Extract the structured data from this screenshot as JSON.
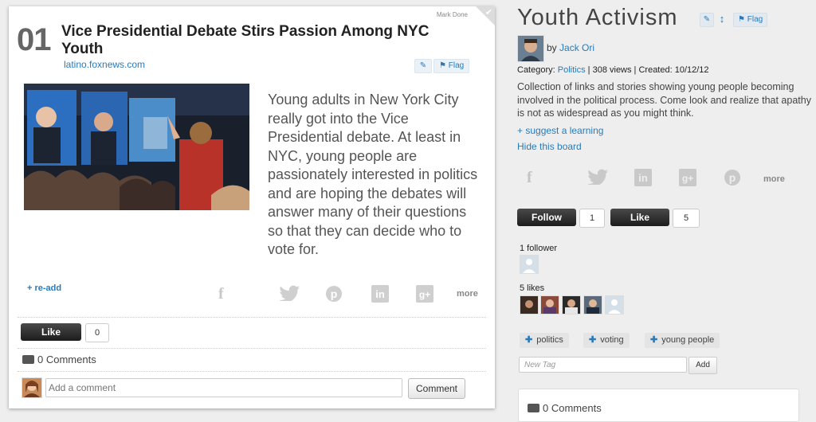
{
  "card": {
    "mark_done": "Mark Done",
    "number": "01",
    "title": "Vice Presidential Debate Stirs Passion Among NYC Youth",
    "source": "latino.foxnews.com",
    "flag_label": "Flag",
    "description": "Young adults in New York City really got into the Vice Presidential debate. At least in NYC, young people are passionately interested in politics and are hoping the debates will answer many of their questions so that they can decide who to vote for.",
    "readd_label": "+ re-add",
    "share_more": "more",
    "like_label": "Like",
    "like_count": "0",
    "comments_label": "0 Comments",
    "comment_placeholder": "Add a comment",
    "comment_button": "Comment"
  },
  "board": {
    "title": "Youth Activism",
    "flag_label": "Flag",
    "by_prefix": "by",
    "author": "Jack Ori",
    "category_prefix": "Category:",
    "category": "Politics",
    "stats": "| 308 views | Created: 10/12/12",
    "description": "Collection of links and stories showing young people becoming involved in the political process. Come look and realize that apathy is not as widespread as you might think.",
    "suggest_label": "+ suggest a learning",
    "hide_label": "Hide this board",
    "share_more": "more",
    "follow_label": "Follow",
    "follow_count": "1",
    "like_label": "Like",
    "like_count": "5",
    "followers_label": "1 follower",
    "likes_label": "5 likes",
    "tags": [
      "politics",
      "voting",
      "young people"
    ],
    "new_tag_placeholder": "New Tag",
    "add_label": "Add",
    "comments_label": "0 Comments"
  },
  "icons": [
    "edit-icon",
    "flag-icon",
    "reorder-icon",
    "facebook-icon",
    "twitter-icon",
    "pinterest-icon",
    "linkedin-icon",
    "googleplus-icon",
    "comment-bubble-icon",
    "check-icon"
  ],
  "colors": {
    "link": "#2a7ab8",
    "dark_button": "#222222",
    "background": "#eeeeee"
  }
}
